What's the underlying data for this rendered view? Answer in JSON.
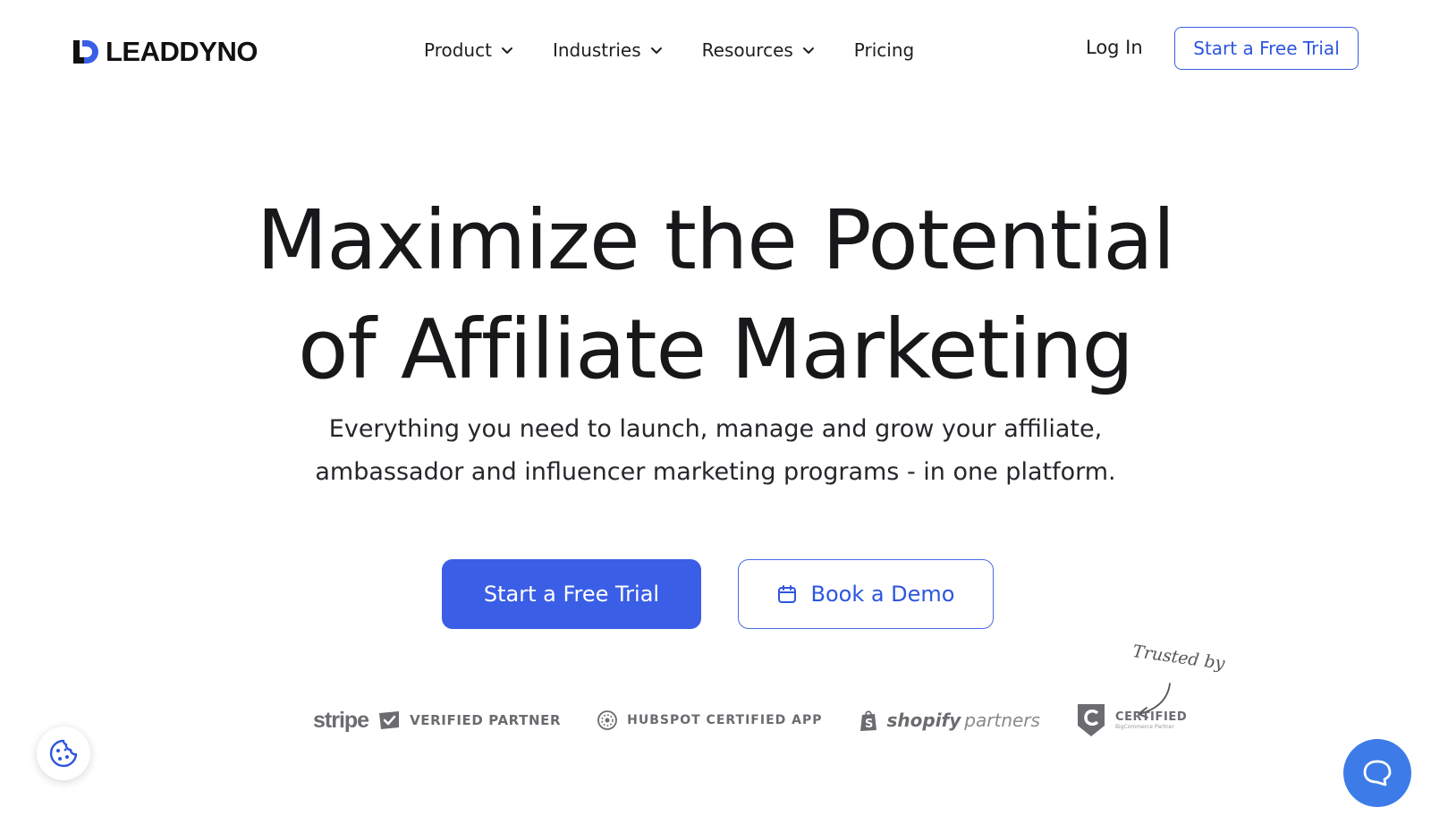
{
  "header": {
    "logo_text": "LEADDYNO",
    "nav": [
      {
        "label": "Product",
        "has_dropdown": true
      },
      {
        "label": "Industries",
        "has_dropdown": true
      },
      {
        "label": "Resources",
        "has_dropdown": true
      },
      {
        "label": "Pricing",
        "has_dropdown": false
      }
    ],
    "login_label": "Log In",
    "cta_label": "Start a Free Trial"
  },
  "hero": {
    "title_line1": "Maximize the Potential",
    "title_line2": "of Affiliate Marketing",
    "subtitle_line1": "Everything you need to launch, manage and grow your affiliate,",
    "subtitle_line2": "ambassador and influencer marketing programs - in one platform.",
    "primary_cta": "Start a Free Trial",
    "secondary_cta": "Book a Demo",
    "secondary_icon": "calendar-icon"
  },
  "trust": {
    "note": "Trusted by",
    "partners": {
      "stripe_word": "stripe",
      "stripe_badge": "VERIFIED PARTNER",
      "hubspot": "HUBSPOT CERTIFIED APP",
      "shopify_word": "shopify",
      "shopify_sub": "partners",
      "bigcommerce_main": "CERTIFIED",
      "bigcommerce_sub": "BigCommerce Partner"
    }
  },
  "widgets": {
    "cookie_icon": "cookie-icon",
    "chat_icon": "chat-bubble-icon"
  },
  "colors": {
    "brand_blue": "#3a5ee5",
    "text_dark": "#18181b",
    "partner_gray": "#6b6b70",
    "chat_blue": "#3d7be8"
  }
}
